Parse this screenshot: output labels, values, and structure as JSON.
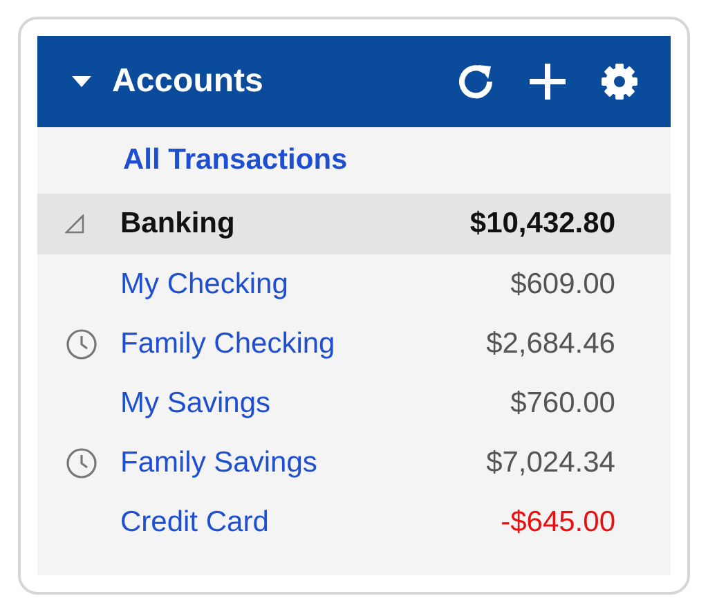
{
  "header": {
    "title": "Accounts",
    "expanded": true
  },
  "all_transactions": "All Transactions",
  "group": {
    "name": "Banking",
    "total": "$10,432.80",
    "expanded": true,
    "accounts": [
      {
        "name": "My Checking",
        "amount": "$609.00",
        "scheduled": false,
        "negative": false
      },
      {
        "name": "Family Checking",
        "amount": "$2,684.46",
        "scheduled": true,
        "negative": false
      },
      {
        "name": "My Savings",
        "amount": "$760.00",
        "scheduled": false,
        "negative": false
      },
      {
        "name": "Family Savings",
        "amount": "$7,024.34",
        "scheduled": true,
        "negative": false
      },
      {
        "name": "Credit Card",
        "amount": "-$645.00",
        "scheduled": false,
        "negative": true
      }
    ]
  }
}
